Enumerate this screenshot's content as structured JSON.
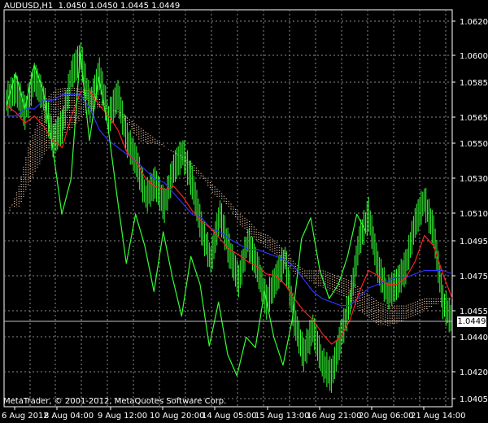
{
  "header": {
    "symbol": "AUDUSD,H1",
    "open": "1.0450",
    "high": "1.0450",
    "low": "1.0445",
    "close": "1.0449"
  },
  "footer": {
    "copyright": "MetaTrader, © 2001-2012, MetaQuotes Software Corp."
  },
  "current_price": "1.0449",
  "colors": {
    "background": "#000000",
    "grid": "#8c8c8c",
    "price": "#33ff33",
    "tenkan": "#ff2020",
    "kijun": "#3030ff",
    "chikou": "#33ff33",
    "cloud": "#f0c8a8"
  },
  "chart_data": {
    "type": "line",
    "indicator": "Ichimoku Kinko Hyo",
    "price_axis": {
      "ticks": [
        "1.0620",
        "1.0600",
        "1.0585",
        "1.0565",
        "1.0550",
        "1.0530",
        "1.0510",
        "1.0495",
        "1.0475",
        "1.0455",
        "1.0440",
        "1.0420",
        "1.0405"
      ]
    },
    "time_axis": {
      "ticks": [
        "6 Aug 2012",
        "8 Aug 04:00",
        "9 Aug 12:00",
        "10 Aug 20:00",
        "14 Aug 05:00",
        "15 Aug 13:00",
        "16 Aug 21:00",
        "20 Aug 06:00",
        "21 Aug 14:00"
      ]
    },
    "series": [
      {
        "id": "price",
        "values": [
          1.0575,
          1.0582,
          1.0568,
          1.0588,
          1.0576,
          1.0552,
          1.056,
          1.059,
          1.06,
          1.0572,
          1.059,
          1.0565,
          1.0578,
          1.0552,
          1.054,
          1.052,
          1.0528,
          1.0515,
          1.0536,
          1.0545,
          1.0528,
          1.0502,
          1.0484,
          1.051,
          1.0489,
          1.0472,
          1.0495,
          1.048,
          1.046,
          1.0473,
          1.0485,
          1.045,
          1.043,
          1.0445,
          1.0425,
          1.0418,
          1.044,
          1.046,
          1.0495,
          1.051,
          1.048,
          1.0465,
          1.047,
          1.048,
          1.0505,
          1.0518,
          1.05,
          1.046,
          1.0449
        ]
      },
      {
        "id": "tenkan",
        "values": [
          1.0572,
          1.0568,
          1.0562,
          1.0566,
          1.056,
          1.0552,
          1.0548,
          1.0566,
          1.058,
          1.058,
          1.0572,
          1.0566,
          1.0558,
          1.0545,
          1.054,
          1.053,
          1.0526,
          1.0524,
          1.0526,
          1.052,
          1.0512,
          1.0506,
          1.0502,
          1.0496,
          1.049,
          1.0487,
          1.0483,
          1.048,
          1.0476,
          1.0475,
          1.047,
          1.0462,
          1.0455,
          1.045,
          1.0442,
          1.0436,
          1.044,
          1.045,
          1.0466,
          1.0478,
          1.0475,
          1.047,
          1.047,
          1.0474,
          1.0483,
          1.0498,
          1.0492,
          1.0476,
          1.0462
        ]
      },
      {
        "id": "kijun",
        "values": [
          1.0566,
          1.0566,
          1.057,
          1.057,
          1.0575,
          1.0575,
          1.0578,
          1.0578,
          1.0578,
          1.057,
          1.0558,
          1.0552,
          1.0548,
          1.0544,
          1.054,
          1.0535,
          1.053,
          1.0528,
          1.0522,
          1.0516,
          1.051,
          1.0508,
          1.0502,
          1.05,
          1.0496,
          1.0493,
          1.049,
          1.049,
          1.0488,
          1.0486,
          1.0484,
          1.048,
          1.0473,
          1.0466,
          1.0462,
          1.046,
          1.0458,
          1.0458,
          1.0463,
          1.0468,
          1.047,
          1.0472,
          1.0474,
          1.0474,
          1.0476,
          1.0478,
          1.0478,
          1.0478,
          1.0476
        ]
      },
      {
        "id": "chikou",
        "values": [
          1.0572,
          1.059,
          1.057,
          1.0595,
          1.058,
          1.0548,
          1.051,
          1.053,
          1.0602,
          1.0552,
          1.0588,
          1.056,
          1.052,
          1.0482,
          1.051,
          1.0492,
          1.0466,
          1.05,
          1.0474,
          1.0452,
          1.0486,
          1.047,
          1.0435,
          1.046,
          1.043,
          1.0418,
          1.044,
          1.0434,
          1.0466,
          1.044,
          1.0424,
          1.045,
          1.0496,
          1.0508,
          1.0478,
          1.0462,
          1.047,
          1.0486,
          1.051,
          1.05
        ]
      },
      {
        "id": "senkou_a",
        "values": [
          1.0514,
          1.0514,
          1.0526,
          1.0536,
          1.0546,
          1.055,
          1.0556,
          1.056,
          1.0566,
          1.057,
          1.057,
          1.057,
          1.0566,
          1.056,
          1.0552,
          1.055,
          1.055,
          1.0548,
          1.0544,
          1.054,
          1.0534,
          1.053,
          1.0522,
          1.0518,
          1.0512,
          1.0504,
          1.0498,
          1.0494,
          1.049,
          1.0486,
          1.048,
          1.0476,
          1.0474,
          1.047,
          1.0468,
          1.0466,
          1.0464,
          1.046,
          1.0455,
          1.045,
          1.0447,
          1.0446,
          1.0448,
          1.045,
          1.0452,
          1.0455,
          1.0458,
          1.046,
          1.0462
        ]
      },
      {
        "id": "senkou_b",
        "values": [
          1.0512,
          1.0526,
          1.0548,
          1.0562,
          1.0576,
          1.0581,
          1.0582,
          1.0582,
          1.0581,
          1.058,
          1.0574,
          1.057,
          1.0568,
          1.0564,
          1.056,
          1.0556,
          1.0552,
          1.0548,
          1.0545,
          1.0542,
          1.0538,
          1.0532,
          1.0527,
          1.0522,
          1.0516,
          1.051,
          1.0506,
          1.05,
          1.0498,
          1.0494,
          1.0488,
          1.0482,
          1.0478,
          1.0478,
          1.0478,
          1.0476,
          1.0474,
          1.0472,
          1.0468,
          1.0464,
          1.046,
          1.0458,
          1.0458,
          1.0458,
          1.046,
          1.0462,
          1.0462,
          1.0462,
          1.0462
        ]
      }
    ]
  }
}
